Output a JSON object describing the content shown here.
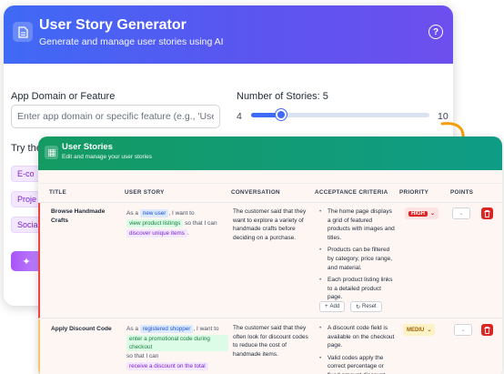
{
  "app": {
    "title": "User Story Generator",
    "subtitle": "Generate and manage user stories using AI"
  },
  "form": {
    "domain_label": "App Domain or Feature",
    "domain_placeholder": "Enter app domain or specific feature (e.g., 'User",
    "count_label": "Number of Stories: 5",
    "slider_min": "4",
    "slider_max": "10",
    "slider_value": 5,
    "try_label": "Try the",
    "chips": [
      "E-co",
      "Proje",
      "Socia"
    ]
  },
  "stories_panel": {
    "title": "User Stories",
    "subtitle": "Edit and manage your user stories"
  },
  "table": {
    "headers": [
      "TITLE",
      "USER STORY",
      "CONVERSATION",
      "ACCEPTANCE CRITERIA",
      "PRIORITY",
      "POINTS"
    ],
    "rows": [
      {
        "title": "Browse Handmade Crafts",
        "story_as": "As a",
        "story_role": "new user",
        "story_want": ", I want to",
        "story_action": "view product listings",
        "story_so": "so that I can",
        "story_benefit": "discover unique items",
        "story_end": ".",
        "conversation": "The customer said that they want to explore a variety of handmade crafts before deciding on a purchase.",
        "criteria": [
          "The home page displays a grid of featured products with images and titles.",
          "Products can be filtered by category, price range, and material.",
          "Each product listing links to a detailed product page."
        ],
        "add_label": "Add",
        "reset_label": "Reset",
        "priority": "HIGH"
      },
      {
        "title": "Apply Discount Code",
        "story_as": "As a",
        "story_role": "registered shopper",
        "story_want": ", I want to",
        "story_action": "enter a promotional code during checkout",
        "story_so": "so that I can",
        "story_benefit": "receive a discount on the total",
        "conversation": "The customer said that they often look for discount codes to reduce the cost of handmade items.",
        "criteria": [
          "A discount code field is available on the checkout page.",
          "Valid codes apply the correct percentage or fixed amount discount"
        ],
        "priority": "MEDIU"
      }
    ]
  },
  "colors": {
    "header_blue": "#3f6af5",
    "header_green": "#149a62",
    "priority_high": "#dc2626",
    "priority_medium": "#fdf3c7",
    "arrow": "#f59e0b"
  }
}
